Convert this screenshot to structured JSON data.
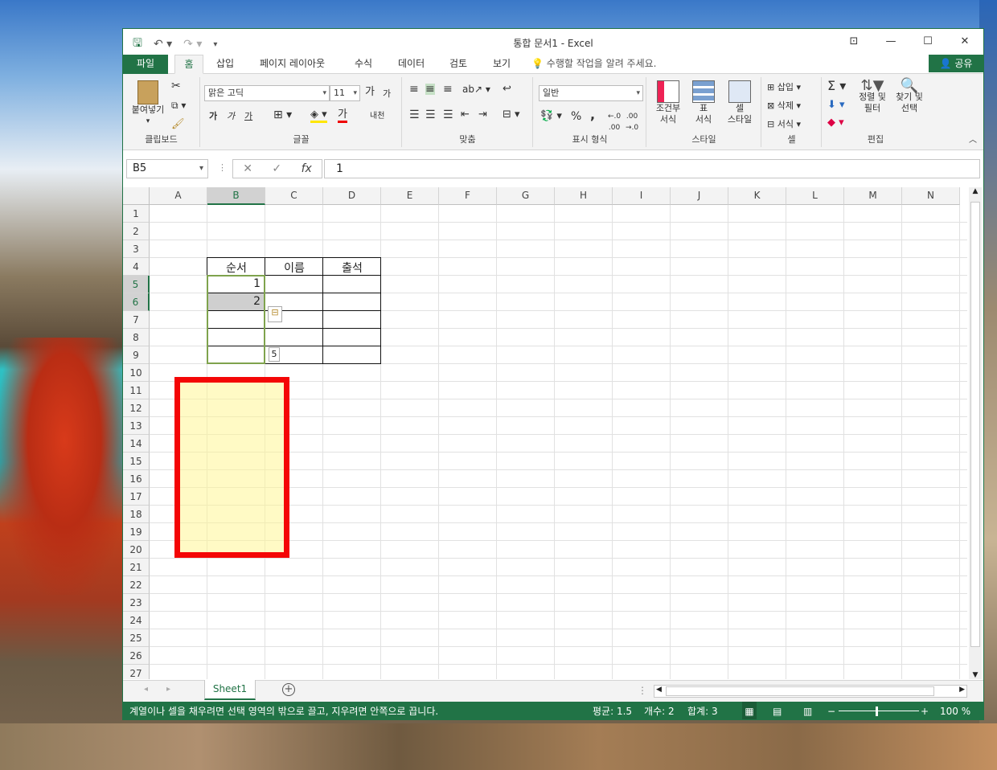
{
  "window": {
    "title": "통합 문서1 - Excel"
  },
  "tabs": {
    "file": "파일",
    "home": "홈",
    "insert": "삽입",
    "layout": "페이지 레이아웃",
    "formulas": "수식",
    "data": "데이터",
    "review": "검토",
    "view": "보기",
    "tellme": "수행할 작업을 알려 주세요.",
    "share": "공유"
  },
  "ribbon": {
    "clipboard": {
      "paste": "붙여넣기",
      "label": "클립보드"
    },
    "font": {
      "name": "맑은 고딕",
      "size": "11",
      "label": "글꼴",
      "bold": "가",
      "italic": "가",
      "underline": "가",
      "grow": "가",
      "shrink": "가",
      "fontcolor": "가",
      "phonetic": "내천"
    },
    "align": {
      "label": "맞춤"
    },
    "number": {
      "format": "일반",
      "label": "표시 형식",
      "percent": "%",
      "comma": ","
    },
    "styles": {
      "cond1": "조건부",
      "cond2": "서식",
      "table1": "표",
      "table2": "서식",
      "cell1": "셀",
      "cell2": "스타일",
      "label": "스타일"
    },
    "cells": {
      "insert": "삽입",
      "delete": "삭제",
      "format": "서식",
      "label": "셀"
    },
    "editing": {
      "sort1": "정렬 및",
      "sort2": "필터",
      "find1": "찾기 및",
      "find2": "선택",
      "label": "편집"
    }
  },
  "formula_bar": {
    "namebox": "B5",
    "value": "1",
    "fx": "fx"
  },
  "columns": [
    "A",
    "B",
    "C",
    "D",
    "E",
    "F",
    "G",
    "H",
    "I",
    "J",
    "K",
    "L",
    "M",
    "N"
  ],
  "rows": [
    "1",
    "2",
    "3",
    "4",
    "5",
    "6",
    "7",
    "8",
    "9",
    "10",
    "11",
    "12",
    "13",
    "14",
    "15",
    "16",
    "17",
    "18",
    "19",
    "20",
    "21",
    "22",
    "23",
    "24",
    "25",
    "26",
    "27"
  ],
  "cells": {
    "B4": "순서",
    "C4": "이름",
    "D4": "출석",
    "B5": "1",
    "B6": "2",
    "tooltip": "5"
  },
  "sheet": {
    "name": "Sheet1"
  },
  "status": {
    "message": "계열이나 셀을 채우려면 선택 영역의 밖으로 끌고, 지우려면 안쪽으로 끕니다.",
    "average": "평균: 1.5",
    "count": "개수: 2",
    "sum": "합계: 3",
    "zoom": "100 %"
  },
  "colors": {
    "accent": "#217346",
    "highlight": "#f40606"
  }
}
